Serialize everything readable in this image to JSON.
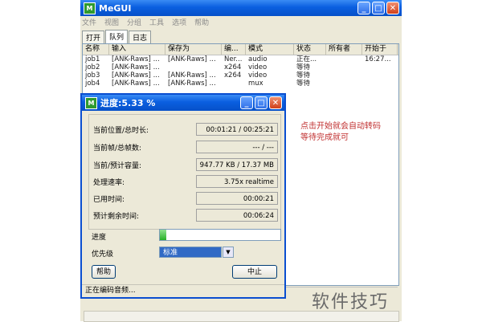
{
  "window": {
    "title": "MeGUI"
  },
  "menu": [
    "文件",
    "视图",
    "分组",
    "工具",
    "选项",
    "帮助"
  ],
  "tabs": [
    "打开",
    "队列",
    "日志"
  ],
  "queue": {
    "columns": [
      "名称",
      "输入",
      "保存为",
      "编...",
      "模式",
      "状态",
      "所有者",
      "开始于"
    ],
    "rows": [
      [
        "job1",
        "[ANK-Raws] ...",
        "[ANK-Raws] ...",
        "Ner...",
        "audio",
        "正在...",
        "",
        "16:27..."
      ],
      [
        "job2",
        "[ANK-Raws] ...",
        "",
        "x264",
        "video",
        "等待",
        "",
        ""
      ],
      [
        "job3",
        "[ANK-Raws] ...",
        "[ANK-Raws] ...",
        "x264",
        "video",
        "等待",
        "",
        ""
      ],
      [
        "job4",
        "[ANK-Raws] ...",
        "[ANK-Raws] ...",
        "",
        "mux",
        "等待",
        "",
        ""
      ]
    ]
  },
  "annotation": [
    "点击开始就会自动转码",
    "等待完成就可"
  ],
  "dialog": {
    "title": "进度:5.33 %",
    "stats": [
      {
        "label": "当前位置/总时长:",
        "value": "00:01:21 / 00:25:21"
      },
      {
        "label": "当前帧/总帧数:",
        "value": "--- / ---"
      },
      {
        "label": "当前/预计容量:",
        "value": "947.77 KB / 17.37 MB"
      },
      {
        "label": "处理速率:",
        "value": "3.75x realtime"
      },
      {
        "label": "已用时间:",
        "value": "00:00:21"
      },
      {
        "label": "预计剩余时间:",
        "value": "00:06:24"
      }
    ],
    "progress_label": "进度",
    "progress_fraction": 0.0533,
    "priority_label": "优先级",
    "priority_value": "标准",
    "help_button": "帮助",
    "abort_button": "中止",
    "status_text": "正在编码音频..."
  },
  "watermark": "软件技巧"
}
